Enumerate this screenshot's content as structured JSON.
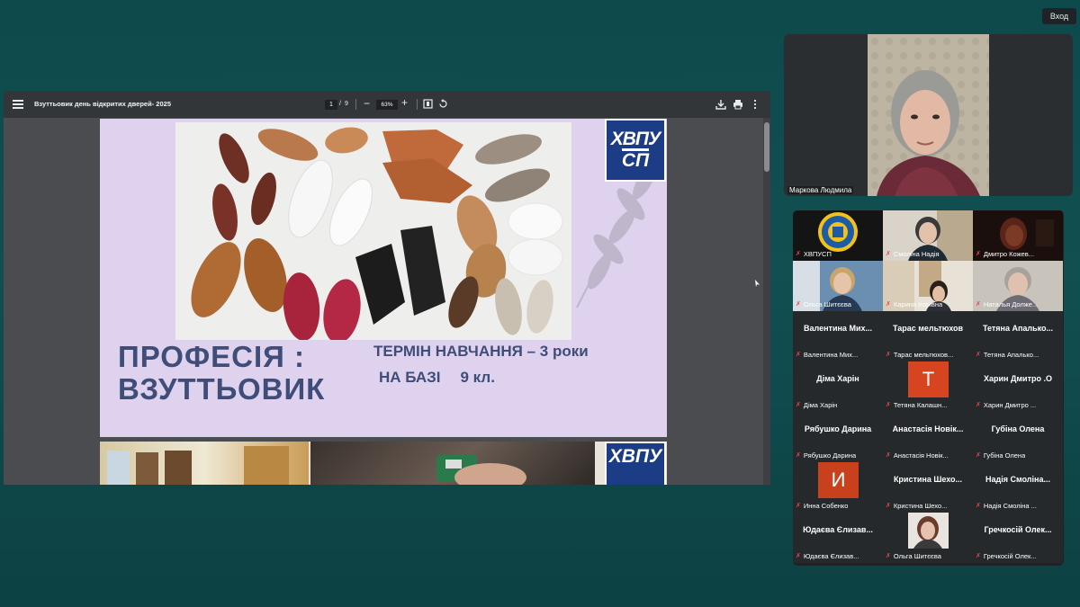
{
  "top_right": {
    "login_label": "Вход"
  },
  "viewer": {
    "doc_title": "Взуттьовик день відкритих дверей- 2025",
    "page_current": "1",
    "page_sep": "/",
    "page_total": "9",
    "zoom_minus": "−",
    "zoom_level": "63%",
    "zoom_plus": "+"
  },
  "slide1": {
    "logo_line1": "ХВПУ",
    "logo_line2": "СП",
    "title_line1": "ПРОФЕСІЯ :",
    "title_line2": "ВЗУТТЬОВИК",
    "term_text": "ТЕРМІН НАВЧАННЯ – 3 роки",
    "base_label": "НА БАЗІ",
    "base_grade": "9 кл."
  },
  "slide2": {
    "logo_text": "ХВПУ"
  },
  "presenter": {
    "name": "Маркова Людмила"
  },
  "participants": [
    {
      "label": "ХВПУСП",
      "type": "logo"
    },
    {
      "label": "Смоліна Надія",
      "type": "video"
    },
    {
      "label": "Дмитро Кожев...",
      "type": "video"
    },
    {
      "label": "Ольга Шитєєва",
      "type": "video"
    },
    {
      "label": "Карина Ігорівна",
      "type": "video"
    },
    {
      "label": "Наталья Долже...",
      "type": "video"
    },
    {
      "label": "Валентина Мих...",
      "display": "Валентина  Мих...",
      "type": "name"
    },
    {
      "label": "Тарас мельтюхов...",
      "display": "Тарас мельтюхов",
      "type": "name"
    },
    {
      "label": "Тетяна Апалько...",
      "display": "Тетяна  Апалько...",
      "type": "name"
    },
    {
      "label": "Діма Харін",
      "display": "Діма Харін",
      "type": "name"
    },
    {
      "label": "Тетяна Калашн...",
      "avatar": "Т",
      "avatar_color": "#d6451f",
      "type": "avatar"
    },
    {
      "label": "Харин Дмитро ...",
      "display": "Харин Дмитро .О",
      "type": "name"
    },
    {
      "label": "Рябушко Дарина",
      "display": "Рябушко Дарина",
      "type": "name"
    },
    {
      "label": "Анастасія Новік...",
      "display": "Анастасія Новік...",
      "type": "name"
    },
    {
      "label": "Губіна Олена",
      "display": "Губіна Олена",
      "type": "name"
    },
    {
      "label": "Инна Собенко",
      "avatar": "И",
      "avatar_color": "#c8401c",
      "type": "avatar"
    },
    {
      "label": "Кристина Шехо...",
      "display": "Кристина  Шехо...",
      "type": "name"
    },
    {
      "label": "Надія Смоліна ...",
      "display": "Надія Смоліна...",
      "type": "name"
    },
    {
      "label": "Юдаєва Єлизав...",
      "display": "Юдаєва Єлизав...",
      "type": "name"
    },
    {
      "label": "Ольга Шитєєва",
      "type": "video"
    },
    {
      "label": "Гречкосій Олек...",
      "display": "Гречкосій Олек...",
      "type": "name"
    }
  ]
}
